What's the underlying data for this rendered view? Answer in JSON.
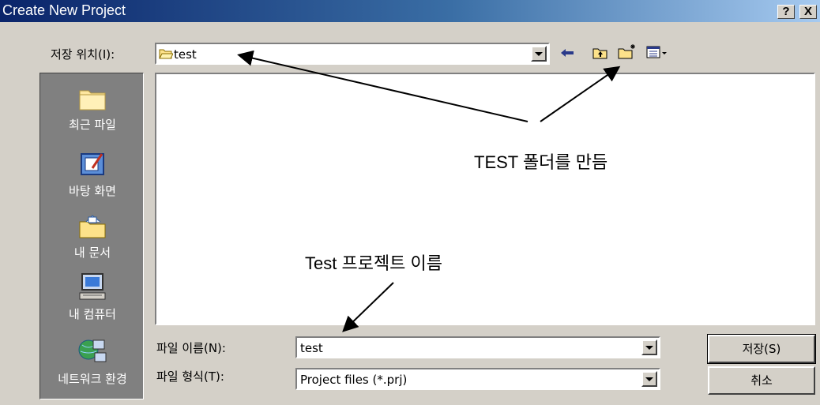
{
  "window": {
    "title": "Create New Project",
    "help_button": "?",
    "close_button": "X"
  },
  "save_location": {
    "label": "저장 위치(I):",
    "value": "test"
  },
  "places_bar": {
    "items": [
      {
        "label": "최근 파일",
        "icon": "recent-folder-icon"
      },
      {
        "label": "바탕 화면",
        "icon": "desktop-icon"
      },
      {
        "label": "내 문서",
        "icon": "my-documents-icon"
      },
      {
        "label": "내 컴퓨터",
        "icon": "my-computer-icon"
      },
      {
        "label": "네트워크 환경",
        "icon": "network-icon"
      }
    ]
  },
  "file_name": {
    "label": "파일 이름(N):",
    "value": "test"
  },
  "file_type": {
    "label": "파일 형식(T):",
    "value": "Project files (*.prj)"
  },
  "buttons": {
    "save": "저장(S)",
    "cancel": "취소"
  },
  "annotations": {
    "folder_note": "TEST 폴더를 만듬",
    "project_note": "Test 프로젝트 이름"
  }
}
